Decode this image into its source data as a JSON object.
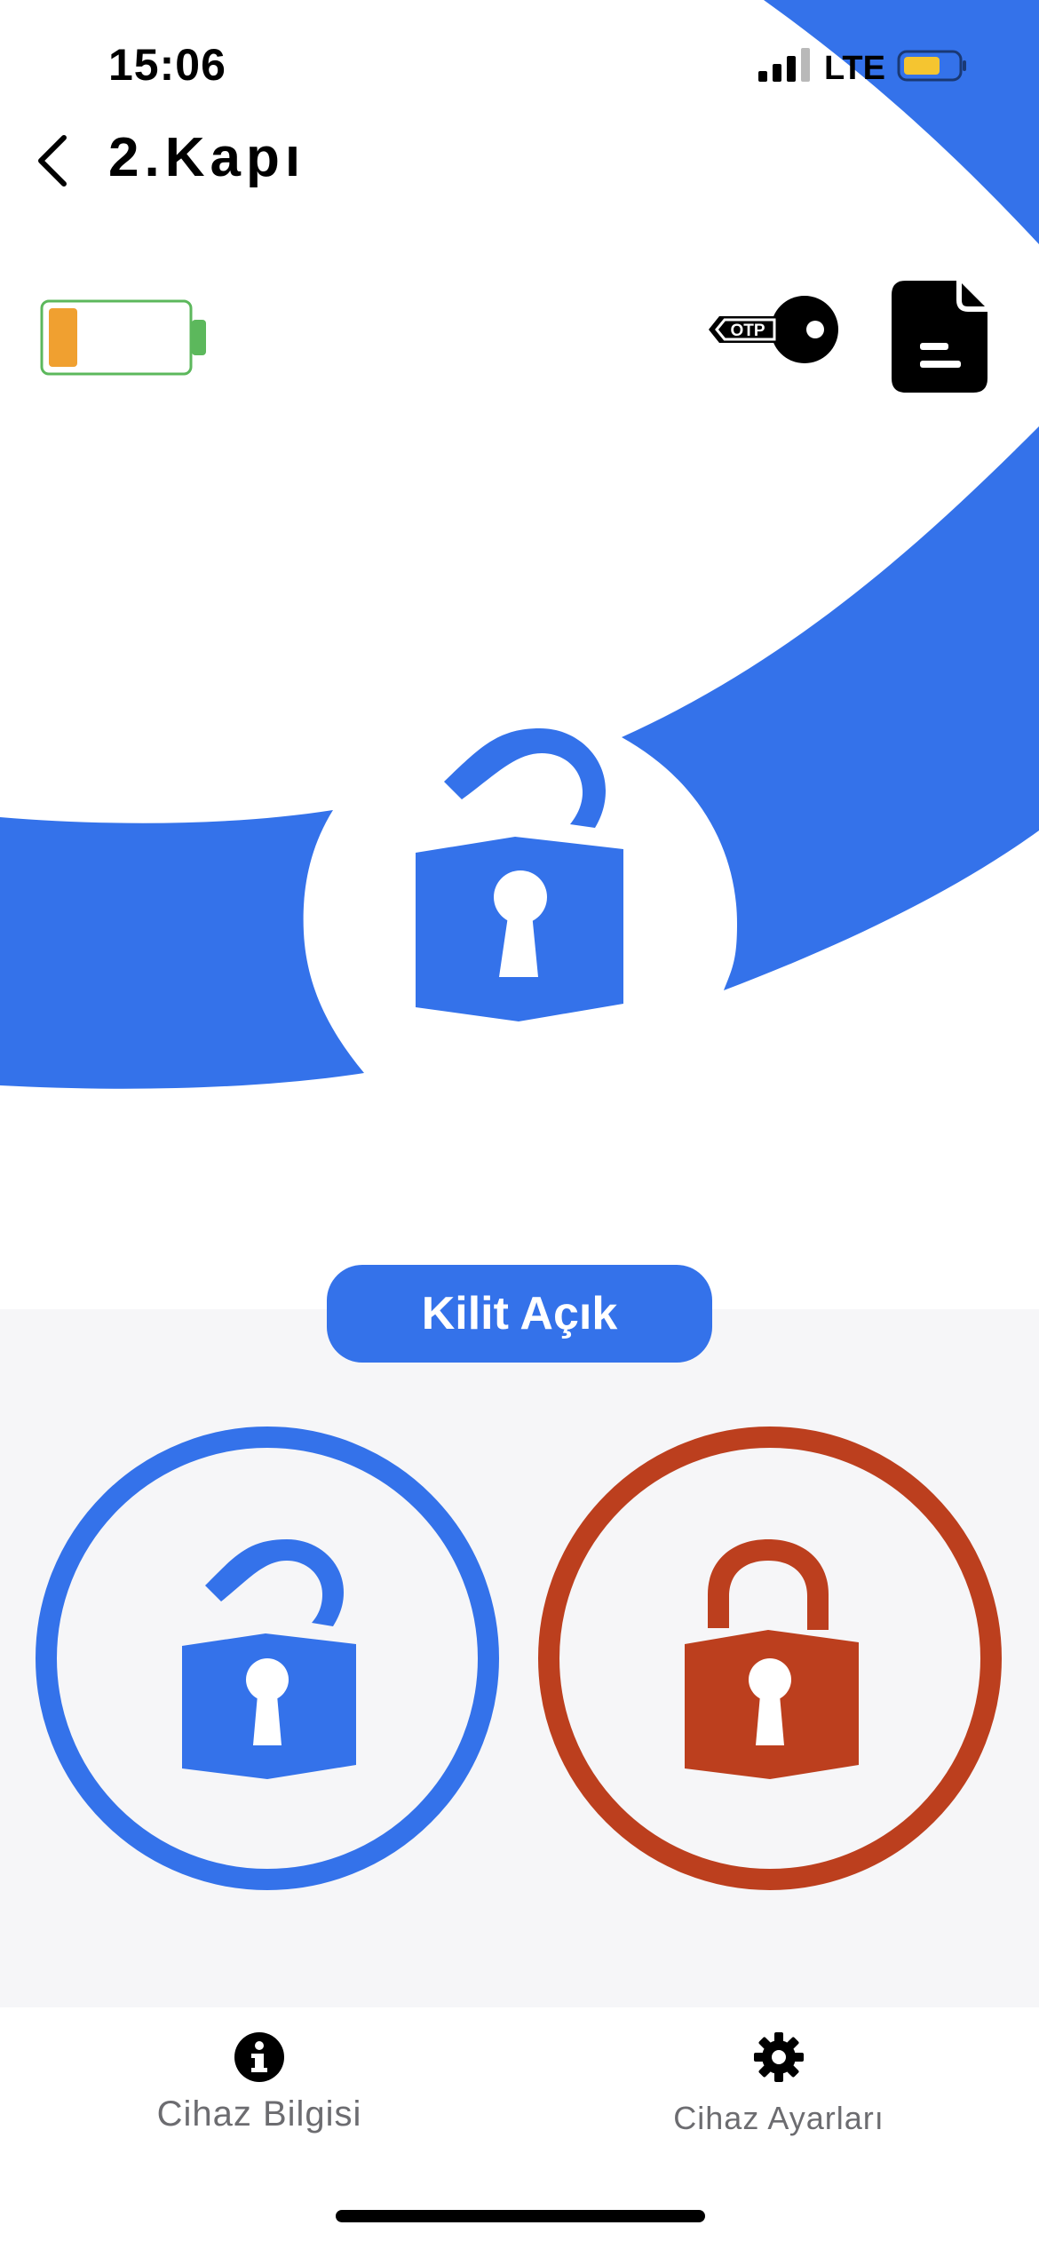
{
  "status_bar": {
    "time": "15:06",
    "network": "LTE"
  },
  "nav": {
    "title": "2.Kapı"
  },
  "top_icons": {
    "otp_label": "OTP"
  },
  "lock_status": {
    "label": "Kilit Açık"
  },
  "tabs": [
    {
      "label": "Cihaz Bilgisi",
      "icon": "info-icon"
    },
    {
      "label": "Cihaz Ayarları",
      "icon": "gear-icon"
    }
  ],
  "colors": {
    "accent_blue": "#3472ea",
    "lock_red": "#bc3f1e",
    "battery_level": "#f0a030",
    "battery_outline": "#5cb85c"
  },
  "device_battery_level": 0.2
}
